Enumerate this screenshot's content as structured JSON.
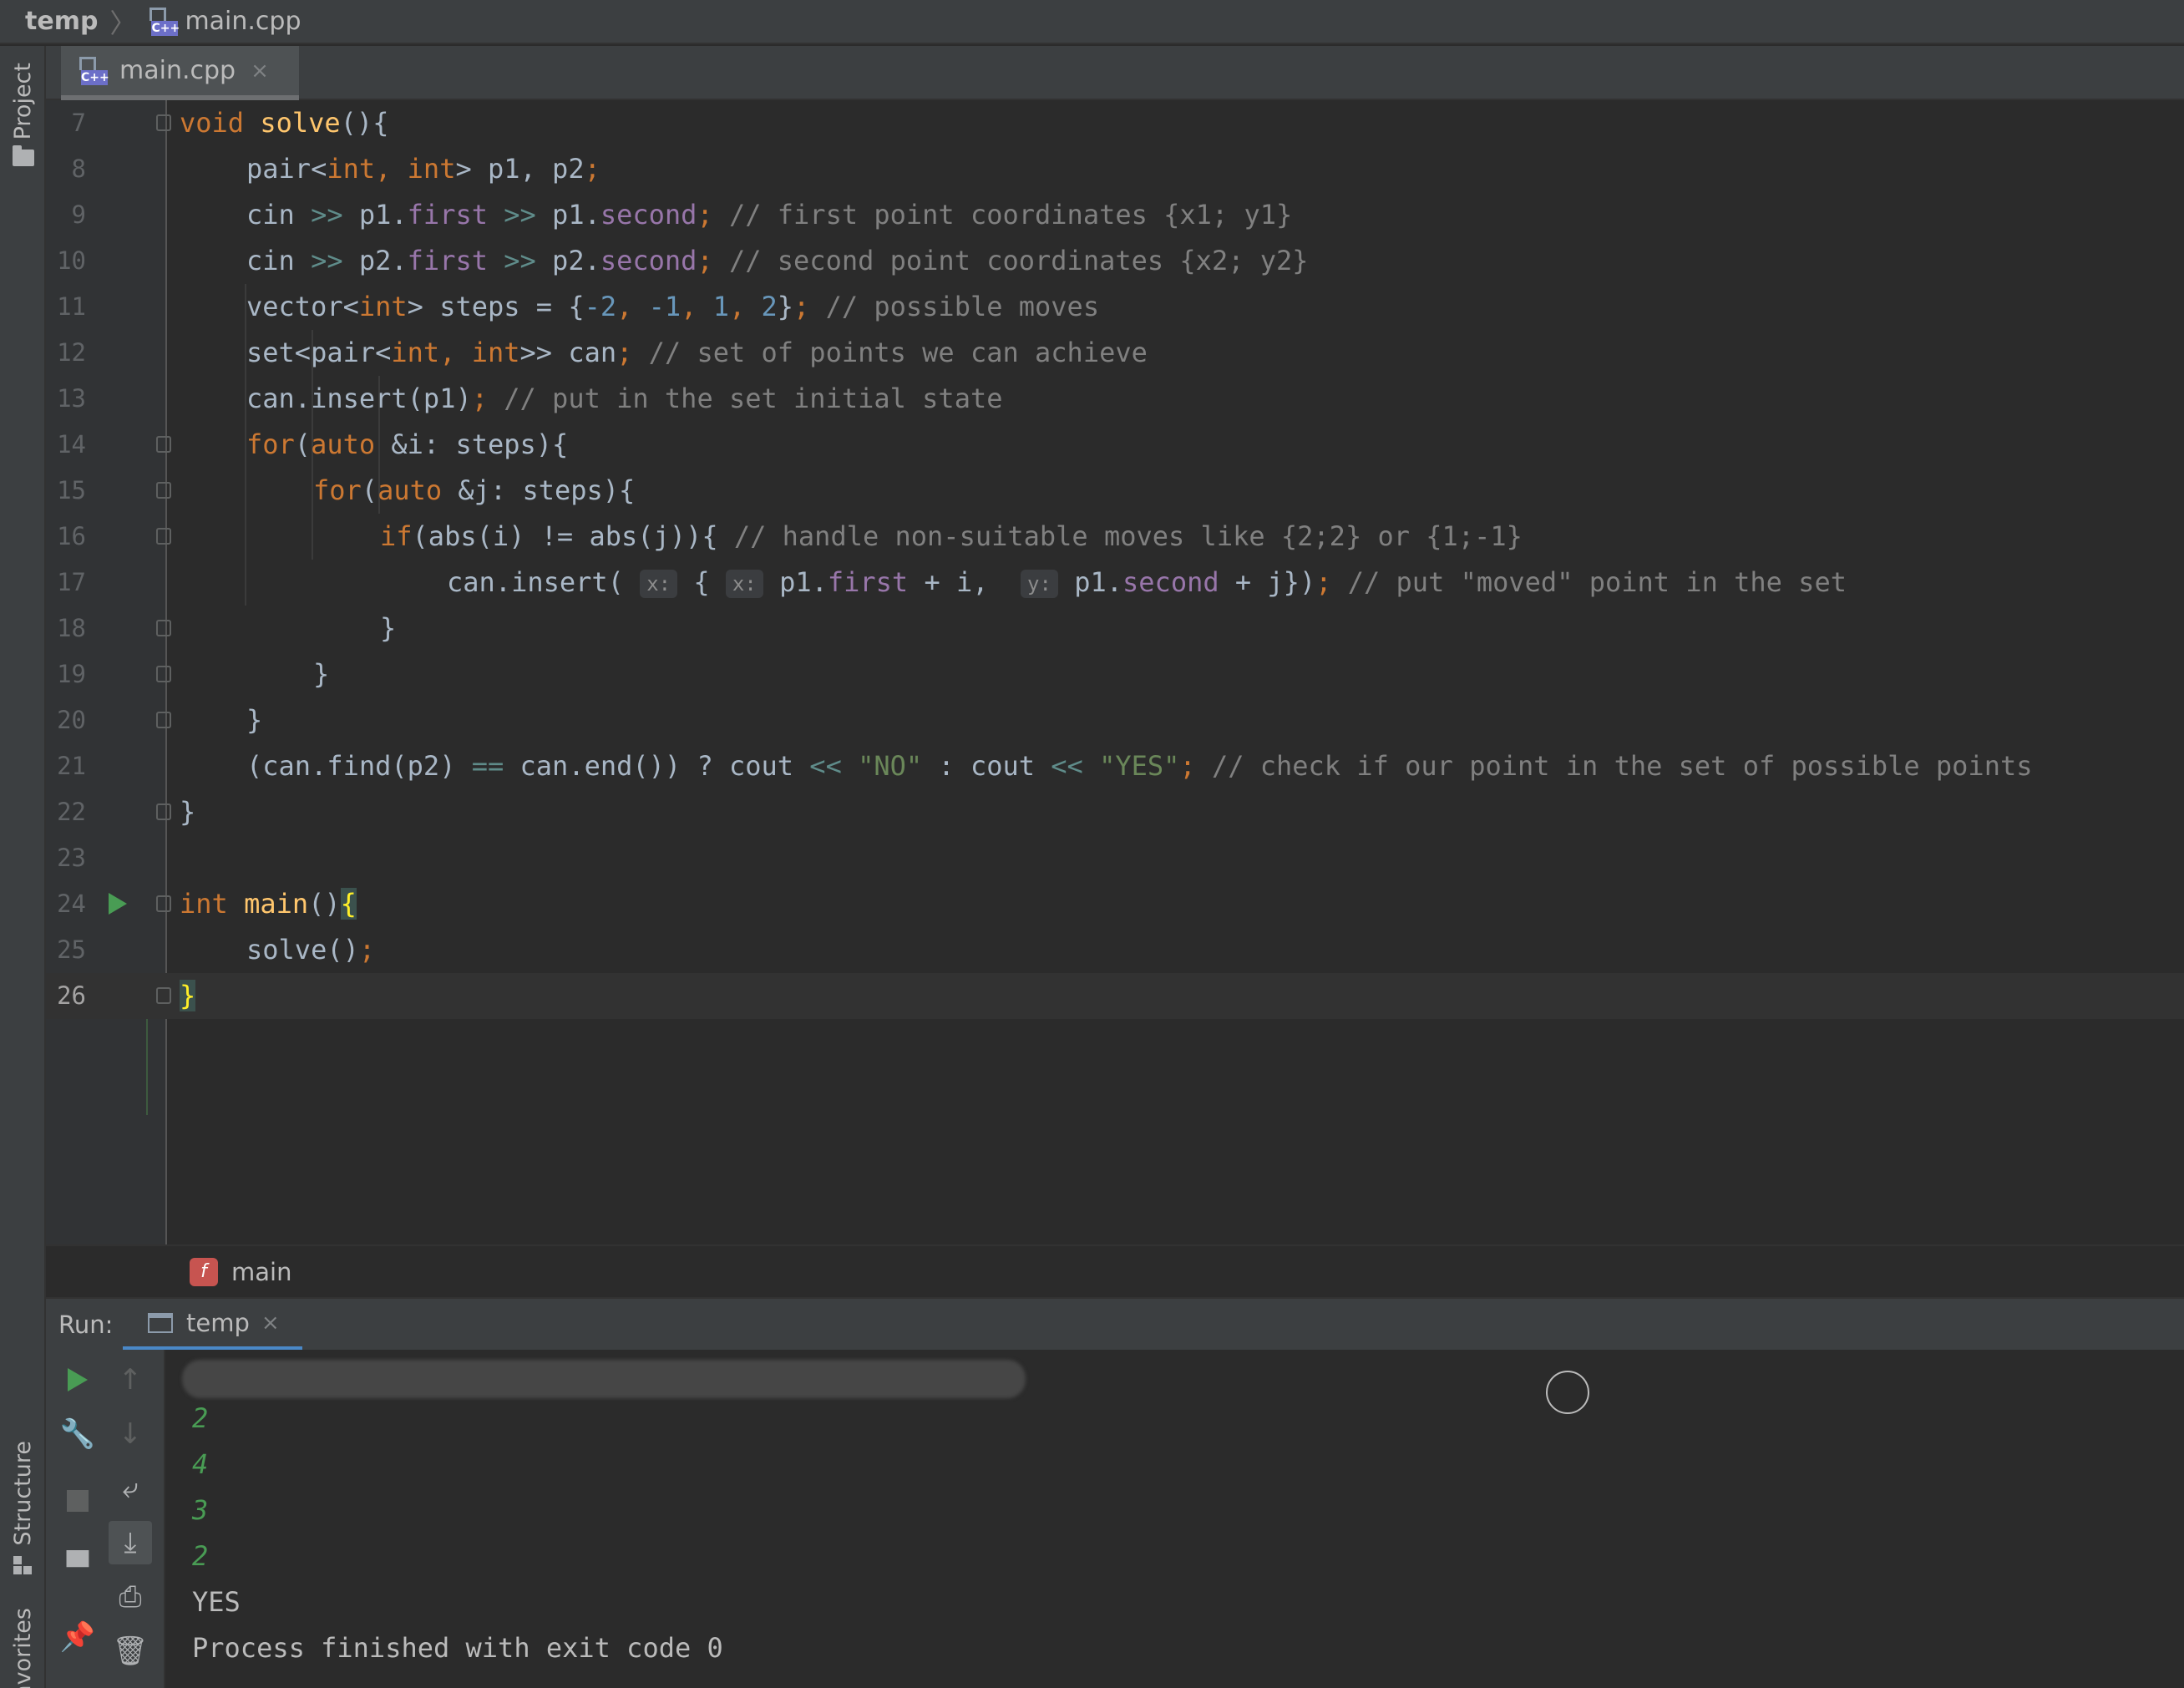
{
  "nav": {
    "project": "temp",
    "file": "main.cpp",
    "file_badge": "C++"
  },
  "left_stripe": {
    "project_tab": "Project",
    "structure_tab": "Structure",
    "favorites_tab": "avorites"
  },
  "editor_tab": {
    "label": "main.cpp",
    "close": "×"
  },
  "code_lines": [
    {
      "num": "7"
    },
    {
      "num": "8"
    },
    {
      "num": "9"
    },
    {
      "num": "10"
    },
    {
      "num": "11"
    },
    {
      "num": "12"
    },
    {
      "num": "13"
    },
    {
      "num": "14"
    },
    {
      "num": "15"
    },
    {
      "num": "16"
    },
    {
      "num": "17"
    },
    {
      "num": "18"
    },
    {
      "num": "19"
    },
    {
      "num": "20"
    },
    {
      "num": "21"
    },
    {
      "num": "22"
    },
    {
      "num": "23"
    },
    {
      "num": "24"
    },
    {
      "num": "25"
    },
    {
      "num": "26"
    }
  ],
  "code_text": {
    "l7_kw": "void",
    "l7_fn": "solve",
    "l7_rest": "(){",
    "l8": [
      "pair<",
      "int",
      ", ",
      "int",
      "> p1, p2",
      ";"
    ],
    "l9": [
      "cin ",
      ">> ",
      "p1.",
      "first",
      " >> ",
      "p1.",
      "second",
      "; ",
      "// first point coordinates {x1; y1}"
    ],
    "l10": [
      "cin ",
      ">> ",
      "p2.",
      "first",
      " >> ",
      "p2.",
      "second",
      "; ",
      "// second point coordinates {x2; y2}"
    ],
    "l11": [
      "vector<",
      "int",
      "> steps = {",
      "-2",
      ", ",
      "-1",
      ", ",
      "1",
      ", ",
      "2",
      "}",
      "; ",
      "// possible moves"
    ],
    "l12": [
      "set<pair<",
      "int",
      ", ",
      "int",
      ">> can",
      "; ",
      "// set of points we can achieve"
    ],
    "l13": [
      "can.insert(p1)",
      "; ",
      "// put in the set initial state"
    ],
    "l14": [
      "for",
      "(",
      "auto",
      " &i: steps){"
    ],
    "l15": [
      "for",
      "(",
      "auto",
      " &j: steps){"
    ],
    "l16": [
      "if",
      "(abs(i) != abs(j)){ ",
      "// handle non-suitable moves like {2;2} or {1;-1}"
    ],
    "l17": [
      "can.insert( ",
      "x:",
      " { ",
      "x:",
      " p1.",
      "first",
      " + i,  ",
      "y:",
      " p1.",
      "second",
      " + j})",
      "; ",
      "// put \"moved\" point in the set"
    ],
    "l18": "}",
    "l19": "}",
    "l20": "}",
    "l21": [
      "(can.find(p2) ",
      "==",
      " can.end()) ? cout ",
      "<<",
      " ",
      "\"NO\"",
      " : cout ",
      "<<",
      " ",
      "\"YES\"",
      "; ",
      "// check if our point in the set of possible points"
    ],
    "l22": "}",
    "l24": [
      "int",
      " ",
      "main",
      "()",
      "{"
    ],
    "l25": [
      "solve()",
      ";"
    ],
    "l26": "}"
  },
  "breadcrumb_footer": {
    "fn_icon": "f",
    "label": "main"
  },
  "run_panel": {
    "label": "Run:",
    "tab": "temp",
    "close": "×"
  },
  "console": {
    "input_lines": [
      "2",
      "4",
      "3",
      "2"
    ],
    "output_lines": [
      "YES",
      "Process finished with exit code 0"
    ]
  },
  "colors": {
    "keyword": "#cc7832",
    "function": "#ffc66d",
    "number": "#6897bb",
    "string": "#6a8759",
    "comment": "#808080",
    "member": "#9876aa",
    "console_input": "#499c54"
  }
}
